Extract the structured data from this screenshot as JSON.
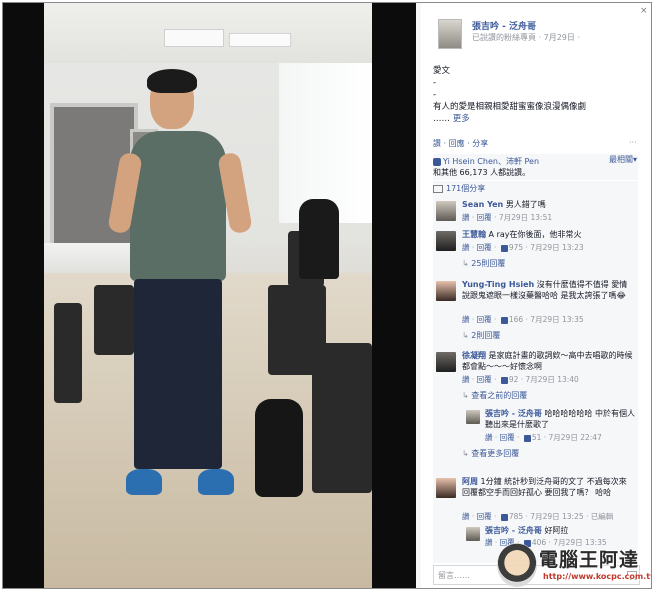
{
  "header": {
    "page_name": "張吉吟 - 泛舟哥",
    "subtitle": "已說讚的粉絲專頁 · 7月29日 · ",
    "close": "×"
  },
  "post": {
    "line1": "愛文",
    "line2": "-",
    "line3": "-",
    "line4": "有人的愛是相親相愛甜蜜蜜像浪漫偶像劇",
    "line5": "……",
    "more": "更多"
  },
  "actions": {
    "like": "讚",
    "reply": "回應",
    "share": "分享",
    "dot": "·",
    "options": "···"
  },
  "likes": {
    "names": "Yi Hsein Chen、沛軒 Pen",
    "count_text": "和其他 66,173 人都說讚。",
    "sort_label": "最相關▾"
  },
  "shares": {
    "text": "171個分享"
  },
  "comments": [
    {
      "name": "Sean Yen",
      "text": "男人錯了嗎",
      "like_label": "讚",
      "reply_label": "回覆",
      "likes": "",
      "time": "7月29日 13:51"
    },
    {
      "name": "王慧翰",
      "text": "A ray在你後面，他非常火",
      "like_label": "讚",
      "reply_label": "回覆",
      "likes": "975",
      "time": "7月29日 13:23",
      "more_replies": "25則回覆"
    },
    {
      "name": "Yung-Ting Hsieh",
      "text": "沒有什麼值得不值得 愛情說跟鬼遮眼一樣沒藥醫哈哈 是我太誇張了嗎😂",
      "like_label": "讚",
      "reply_label": "回覆",
      "likes": "166",
      "time": "7月29日 13:35",
      "more_replies": "2則回覆"
    },
    {
      "name": "徐凝翔",
      "text": "是家庭計畫的歌詞欸～高中去唱歌的時候都會點～～～好懷念啊",
      "like_label": "讚",
      "reply_label": "回覆",
      "likes": "92",
      "time": "7月29日 13:40",
      "prev_replies": "查看之前的回覆"
    },
    {
      "name": "張吉吟 - 泛舟哥",
      "text": "哈哈哈哈哈哈 中於有個人聽出來是什麼歌了",
      "like_label": "讚",
      "reply_label": "回覆",
      "likes": "51",
      "time": "7月29日 22:47",
      "more_replies": "查看更多回覆"
    },
    {
      "name": "阿周",
      "text": "1分鐘 統計秒到泛舟哥的文了 不過每次來回覆都空手而回好孤心 要回我了嗎？ 哈哈",
      "like_label": "讚",
      "reply_label": "回覆",
      "likes": "785",
      "time": "7月29日 13:25",
      "edited": "已編輯"
    },
    {
      "name": "張吉吟 - 泛舟哥",
      "text": "好阿拉",
      "like_label": "讚",
      "reply_label": "回覆",
      "likes": "406",
      "time": "7月29日 13:35"
    }
  ],
  "composer": {
    "placeholder": "留言……"
  },
  "watermark": {
    "brand": "電腦王阿達",
    "url": "http://www.kocpc.com.tw"
  }
}
